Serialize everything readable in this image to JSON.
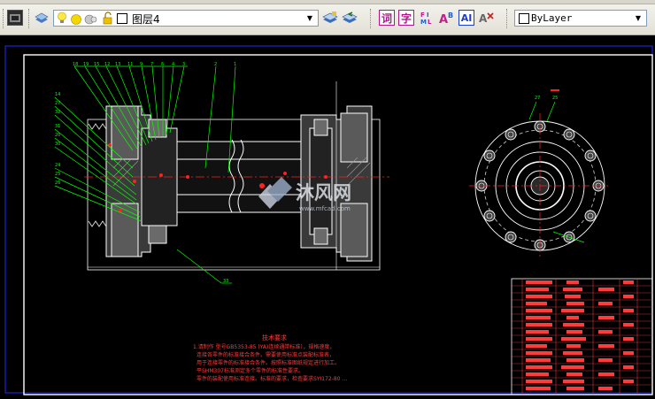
{
  "toolbar": {
    "layer_name": "图层4",
    "layer_dropdown_arrow": "▼",
    "text_tool_ci": "词",
    "text_tool_zi": "字",
    "text_tool_ai": "AI",
    "linetype_value": "ByLayer",
    "linetype_dropdown_arrow": "▼"
  },
  "drawing": {
    "notes_title": "技术要求",
    "notes_line1": "1.请制作 型号GB5353-85 (YA)连续通带标准），规格速度，",
    "notes_line2": "连接各零件的标准接合条件。需要使用标准点装配标准表，",
    "notes_line3": "用于连接零件的标准接合条件。按照标准图纸规定进行加工。",
    "notes_line4": "平SHM307标准测定多个零件的标准性要求。",
    "notes_line5": "零件的装配使用标准连接。标准的要求，检查要求SYI172-80 …",
    "watermark_text": "沐风网",
    "watermark_url": "www.mfcad.com"
  },
  "colors": {
    "canvas_bg": "#000000",
    "frame_line": "#ffffff",
    "leader_line": "#00ff00",
    "annotation_text": "#ff3b3b",
    "centerline": "#ff2020",
    "outer_border": "#1e2cff"
  }
}
